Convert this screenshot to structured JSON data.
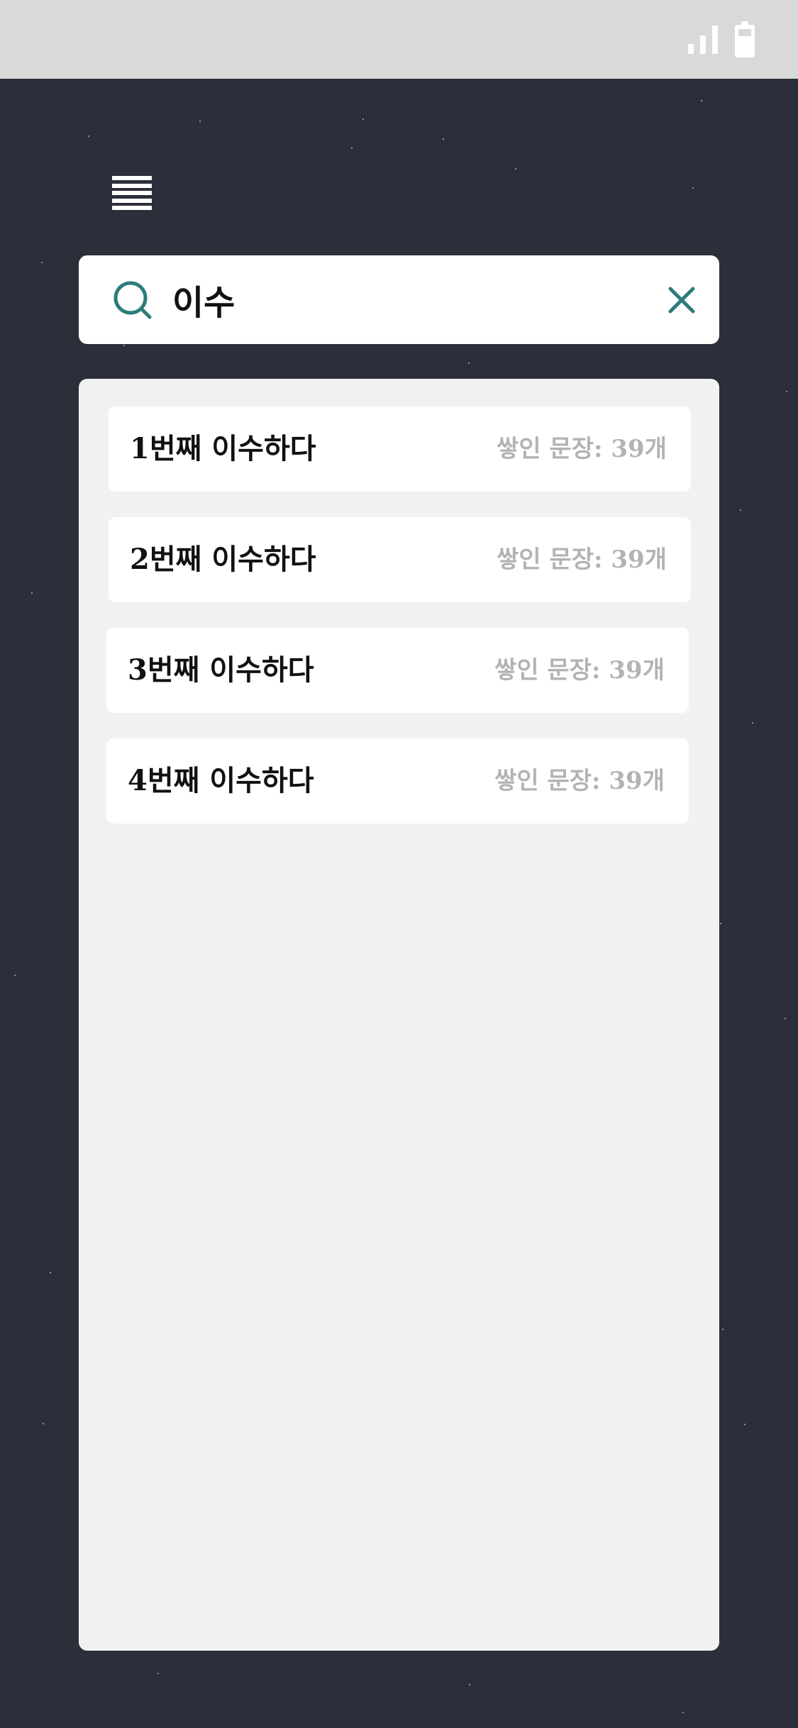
{
  "status_bar": {
    "background": "#d9d9d9",
    "icons": [
      "signal-icon",
      "battery-icon"
    ]
  },
  "menu": {
    "icon": "hamburger-menu-icon"
  },
  "search": {
    "query": "이수",
    "search_icon": "search-icon",
    "clear_icon": "close-icon",
    "accent_color": "#2e7b7b"
  },
  "results": [
    {
      "title": "1번째 이수하다",
      "meta": "쌓인 문장: 39개"
    },
    {
      "title": "2번째 이수하다",
      "meta": "쌓인 문장: 39개"
    },
    {
      "title": "3번째 이수하다",
      "meta": "쌓인 문장: 39개"
    },
    {
      "title": "4번째 이수하다",
      "meta": "쌓인 문장: 39개"
    }
  ],
  "colors": {
    "background": "#2b2f3a",
    "panel": "#f1f1f1",
    "card": "#ffffff",
    "title_text": "#111111",
    "meta_text": "#b3b3b3"
  }
}
